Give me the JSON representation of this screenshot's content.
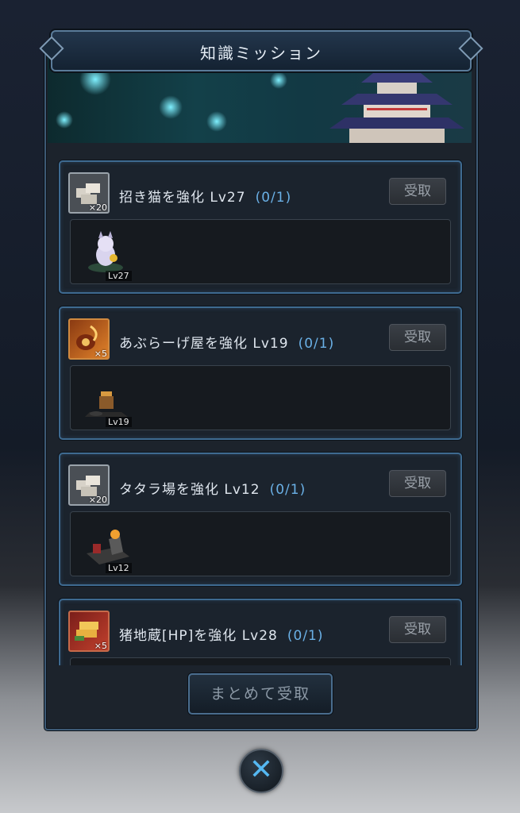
{
  "window": {
    "title": "知識ミッション"
  },
  "missions": [
    {
      "text": "招き猫を強化 Lv27",
      "progress": "(0/1)",
      "reward_qty": "×20",
      "target_level": "Lv27",
      "button": "受取",
      "reward_icon": "stone-blocks-icon",
      "target_icon": "lucky-cat-icon"
    },
    {
      "text": "あぶらーげ屋を強化 Lv19",
      "progress": "(0/1)",
      "reward_qty": "×5",
      "target_level": "Lv19",
      "button": "受取",
      "reward_icon": "fire-pouch-icon",
      "target_icon": "fried-tofu-shop-icon"
    },
    {
      "text": "タタラ場を強化 Lv12",
      "progress": "(0/1)",
      "reward_qty": "×20",
      "target_level": "Lv12",
      "button": "受取",
      "reward_icon": "stone-blocks-icon",
      "target_icon": "tatara-forge-icon"
    },
    {
      "text": "猪地蔵[HP]を強化 Lv28",
      "progress": "(0/1)",
      "reward_qty": "×5",
      "target_level": "",
      "button": "受取",
      "reward_icon": "gold-bars-icon",
      "target_icon": ""
    }
  ],
  "footer": {
    "bulk_button": "まとめて受取"
  },
  "close": {
    "label": "✕",
    "icon": "close-icon"
  }
}
